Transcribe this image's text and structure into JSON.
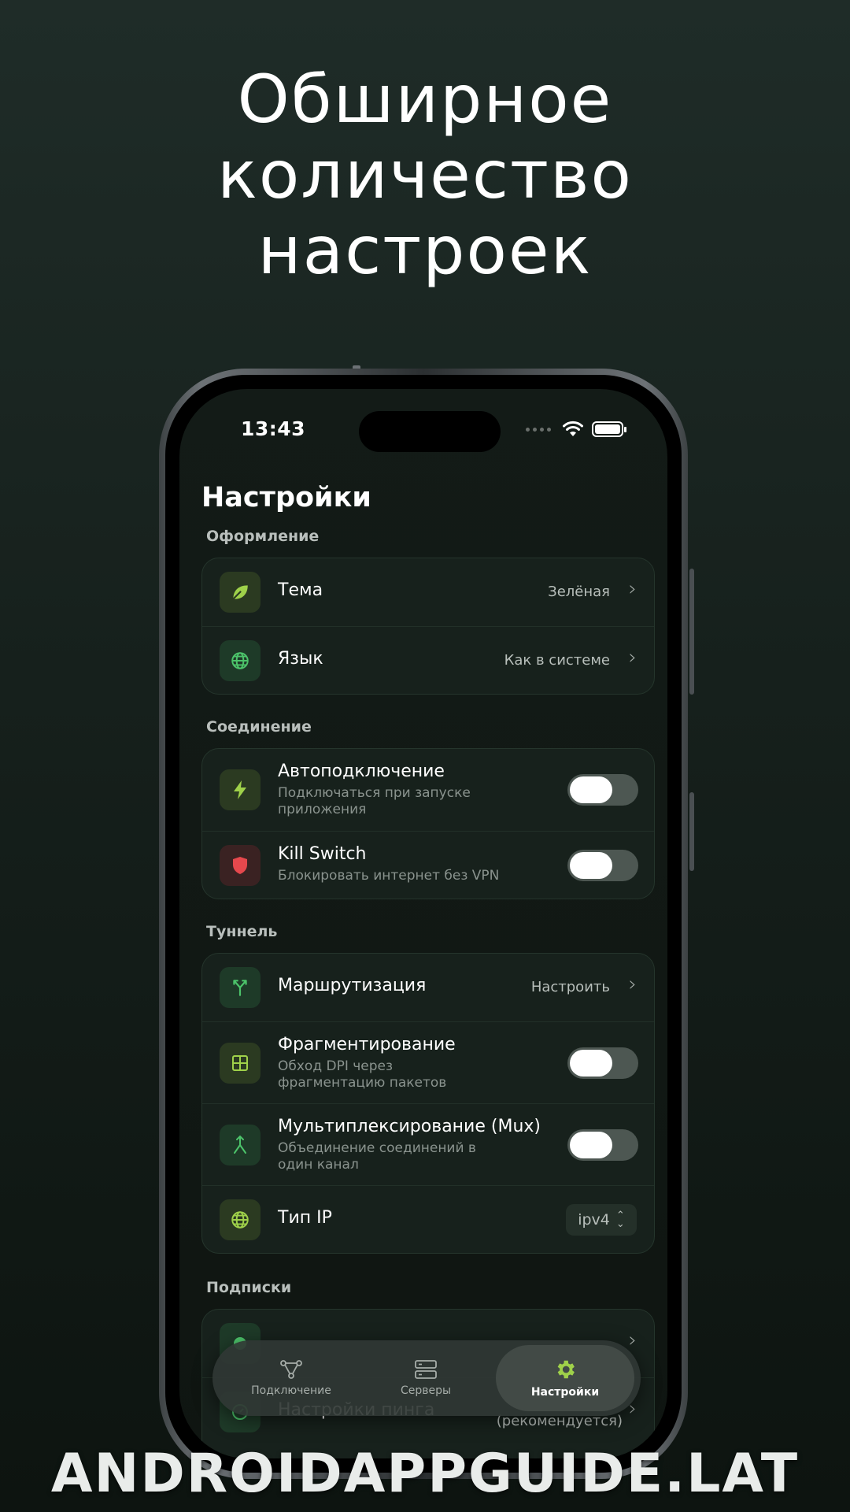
{
  "promo": {
    "title_lines": [
      "Обширное",
      "количество",
      "настроек"
    ]
  },
  "status_bar": {
    "time": "13:43"
  },
  "page": {
    "title": "Настройки"
  },
  "sections": {
    "appearance": {
      "label": "Оформление",
      "theme": {
        "title": "Тема",
        "value": "Зелёная"
      },
      "language": {
        "title": "Язык",
        "value": "Как в системе"
      }
    },
    "connection": {
      "label": "Соединение",
      "autoconnect": {
        "title": "Автоподключение",
        "subtitle": "Подключаться при запуске приложения",
        "enabled": false
      },
      "killswitch": {
        "title": "Kill Switch",
        "subtitle": "Блокировать интернет без VPN",
        "enabled": false
      }
    },
    "tunnel": {
      "label": "Туннель",
      "routing": {
        "title": "Маршрутизация",
        "value": "Настроить"
      },
      "fragmentation": {
        "title": "Фрагментирование",
        "subtitle": "Обход DPI через фрагментацию пакетов",
        "enabled": false
      },
      "mux": {
        "title": "Мультиплексирование (Mux)",
        "subtitle": "Объединение соединений в один канал",
        "enabled": false
      },
      "ip_type": {
        "title": "Тип IP",
        "value": "ipv4"
      }
    },
    "subscriptions": {
      "label": "Подписки",
      "ping": {
        "title": "Настройки пинга",
        "value": "(рекомендуется)"
      }
    }
  },
  "tabbar": {
    "tabs": [
      {
        "label": "Подключение",
        "icon": "connection-icon"
      },
      {
        "label": "Серверы",
        "icon": "servers-icon"
      },
      {
        "label": "Настройки",
        "icon": "gear-icon",
        "active": true
      }
    ]
  },
  "colors": {
    "accent": "#9fd14a",
    "killswitch_red": "#e5484d",
    "green_icon": "#4cc36a"
  },
  "watermark": "ANDROIDAPPGUIDE.LAT"
}
